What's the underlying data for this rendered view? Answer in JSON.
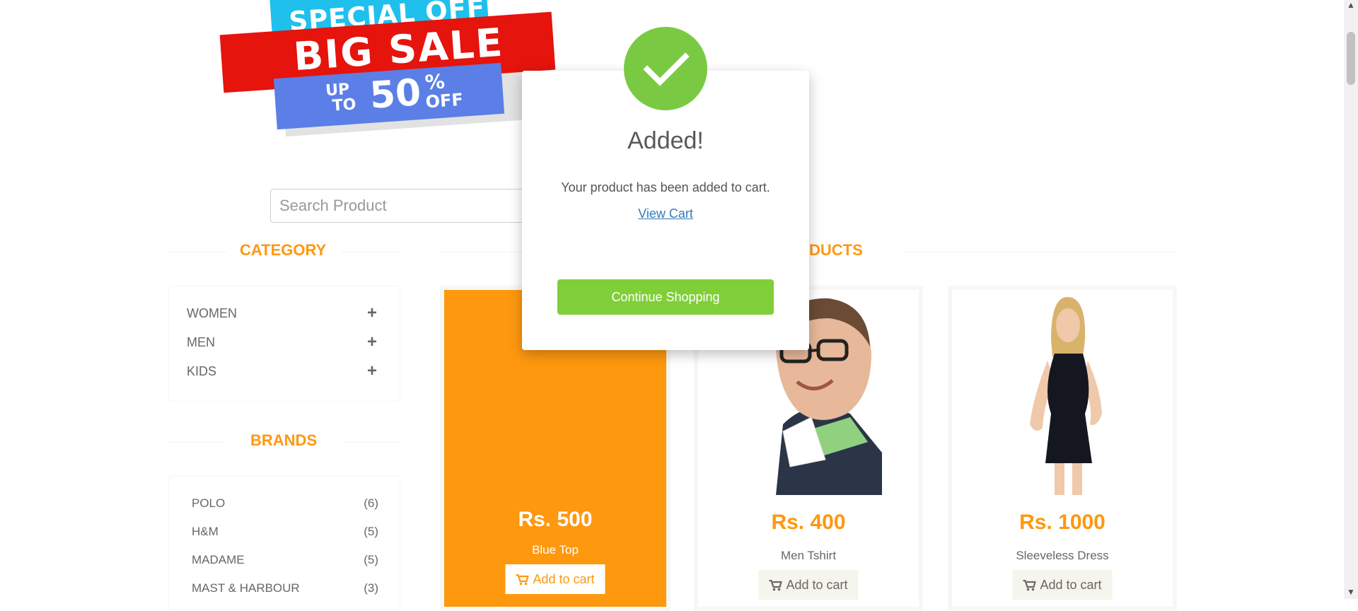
{
  "banner": {
    "line1": "SPECIAL OFFER",
    "line2": "BIG SALE",
    "up": "UP",
    "to": "TO",
    "number": "50",
    "percent": "%",
    "off": "OFF"
  },
  "search": {
    "placeholder": "Search Product"
  },
  "category": {
    "title": "CATEGORY",
    "items": [
      {
        "label": "WOMEN",
        "icon": "+"
      },
      {
        "label": "MEN",
        "icon": "+"
      },
      {
        "label": "KIDS",
        "icon": "+"
      }
    ]
  },
  "brands": {
    "title": "BRANDS",
    "items": [
      {
        "label": "POLO",
        "count": "(6)"
      },
      {
        "label": "H&M",
        "count": "(5)"
      },
      {
        "label": "MADAME",
        "count": "(5)"
      },
      {
        "label": "MAST & HARBOUR",
        "count": "(3)"
      }
    ]
  },
  "products": {
    "title_visible": "DUCTS",
    "items": [
      {
        "price": "Rs. 500",
        "name": "Blue Top",
        "button": "Add to cart"
      },
      {
        "price": "Rs. 400",
        "name": "Men Tshirt",
        "button": "Add to cart"
      },
      {
        "price": "Rs. 1000",
        "name": "Sleeveless Dress",
        "button": "Add to cart"
      }
    ]
  },
  "modal": {
    "title": "Added!",
    "message": "Your product has been added to cart.",
    "link": "View Cart",
    "button": "Continue Shopping"
  },
  "colors": {
    "accent": "#FE980F",
    "success": "#7ac943",
    "continue_button": "#80cf38",
    "link": "#337ab7"
  },
  "icons": [
    "check-icon",
    "plus-icon",
    "cart-icon",
    "scroll-up-icon",
    "scroll-down-icon"
  ]
}
